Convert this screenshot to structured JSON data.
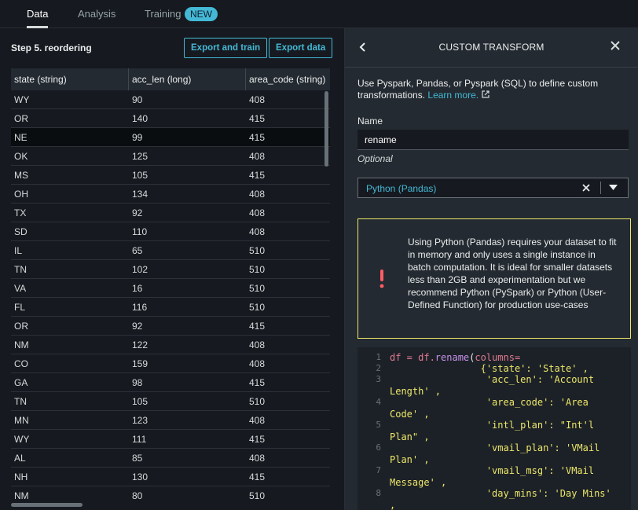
{
  "tabs": {
    "data": "Data",
    "analysis": "Analysis",
    "training": "Training",
    "new_badge": "NEW"
  },
  "left": {
    "step_title": "Step 5. reordering",
    "export_train": "Export and train",
    "export_data": "Export data"
  },
  "table": {
    "columns": [
      "state (string)",
      "acc_len (long)",
      "area_code (string)"
    ],
    "rows": [
      [
        "WY",
        "90",
        "408"
      ],
      [
        "OR",
        "140",
        "415"
      ],
      [
        "NE",
        "99",
        "415"
      ],
      [
        "OK",
        "125",
        "408"
      ],
      [
        "MS",
        "105",
        "415"
      ],
      [
        "OH",
        "134",
        "408"
      ],
      [
        "TX",
        "92",
        "408"
      ],
      [
        "SD",
        "110",
        "408"
      ],
      [
        "IL",
        "65",
        "510"
      ],
      [
        "TN",
        "102",
        "510"
      ],
      [
        "VA",
        "16",
        "510"
      ],
      [
        "FL",
        "116",
        "510"
      ],
      [
        "OR",
        "92",
        "415"
      ],
      [
        "NM",
        "122",
        "408"
      ],
      [
        "CO",
        "159",
        "408"
      ],
      [
        "GA",
        "98",
        "415"
      ],
      [
        "TN",
        "105",
        "510"
      ],
      [
        "MN",
        "123",
        "408"
      ],
      [
        "WY",
        "111",
        "415"
      ],
      [
        "AL",
        "85",
        "408"
      ],
      [
        "NH",
        "130",
        "415"
      ],
      [
        "NM",
        "80",
        "510"
      ]
    ]
  },
  "panel": {
    "title": "CUSTOM TRANSFORM",
    "description": "Use Pyspark, Pandas, or Pyspark (SQL) to define custom transformations.",
    "learn_more": "Learn more.",
    "name_label": "Name",
    "name_value": "rename",
    "optional_label": "Optional",
    "language_selected": "Python (Pandas)",
    "warning_text": "Using Python (Pandas) requires your dataset to fit in memory and only uses a single instance in batch computation. It is ideal for smaller datasets less than 2GB and experimentation but we recommend Python (PySpark) or Python (User-Defined Function) for production use-cases"
  },
  "code": {
    "lines": [
      {
        "n": "1",
        "t": "df = df.rename(columns="
      },
      {
        "n": "2",
        "t": "                {'state': 'State' ,"
      },
      {
        "n": "3",
        "t": "                 'acc_len': 'Account"
      },
      {
        "n": "",
        "t": "Length' ,"
      },
      {
        "n": "4",
        "t": "                 'area_code': 'Area"
      },
      {
        "n": "",
        "t": "Code' ,"
      },
      {
        "n": "5",
        "t": "                 'intl_plan': \"Int'l"
      },
      {
        "n": "",
        "t": "Plan\" ,"
      },
      {
        "n": "6",
        "t": "                 'vmail_plan': 'VMail"
      },
      {
        "n": "",
        "t": "Plan' ,"
      },
      {
        "n": "7",
        "t": "                 'vmail_msg': 'VMail"
      },
      {
        "n": "",
        "t": "Message' ,"
      },
      {
        "n": "8",
        "t": "                 'day_mins': 'Day Mins'"
      },
      {
        "n": "",
        "t": ","
      }
    ]
  }
}
